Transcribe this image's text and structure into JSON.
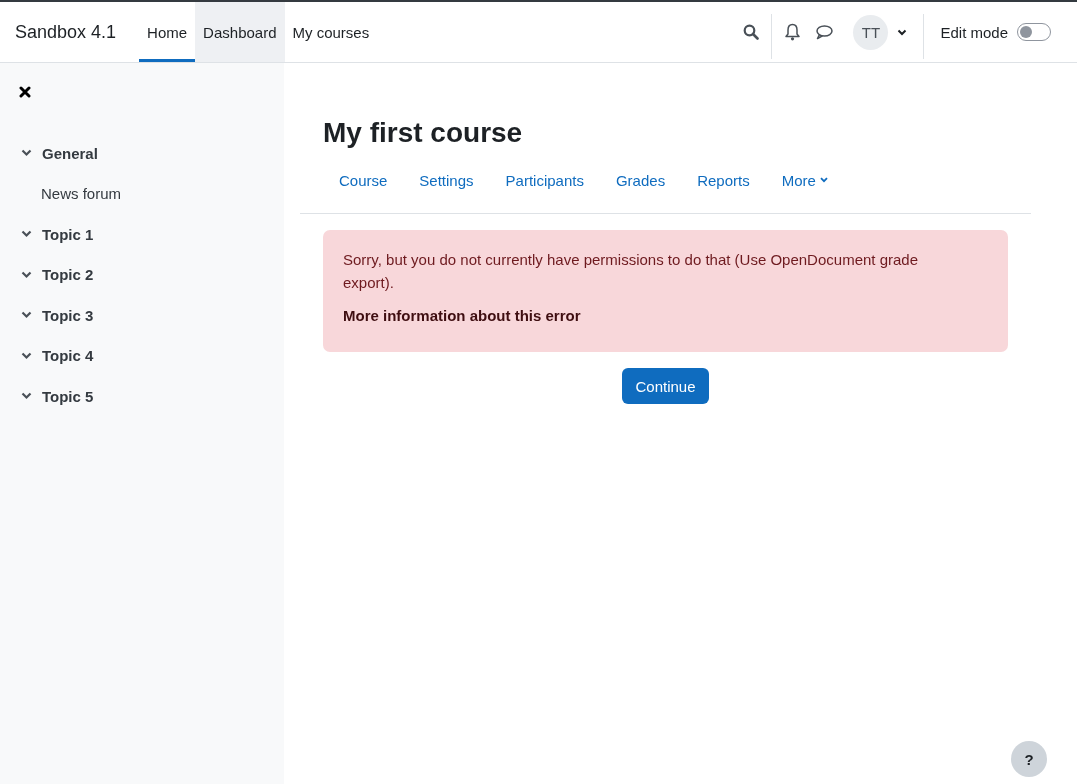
{
  "navbar": {
    "site_name": "Sandbox 4.1",
    "links": [
      {
        "label": "Home",
        "selected": true,
        "highlighted": false
      },
      {
        "label": "Dashboard",
        "selected": false,
        "highlighted": true
      },
      {
        "label": "My courses",
        "selected": false,
        "highlighted": false
      }
    ],
    "avatar_initials": "TT",
    "edit_mode": {
      "label": "Edit mode",
      "on": false
    }
  },
  "sidebar": {
    "items": [
      {
        "label": "General",
        "expanded": true,
        "children": [
          {
            "label": "News forum"
          }
        ]
      },
      {
        "label": "Topic 1",
        "expanded": true
      },
      {
        "label": "Topic 2",
        "expanded": true
      },
      {
        "label": "Topic 3",
        "expanded": true
      },
      {
        "label": "Topic 4",
        "expanded": true
      },
      {
        "label": "Topic 5",
        "expanded": true
      }
    ]
  },
  "page": {
    "title": "My first course",
    "tabs": [
      {
        "label": "Course",
        "selected": false,
        "kind": "link"
      },
      {
        "label": "Settings",
        "selected": false,
        "kind": "link"
      },
      {
        "label": "Participants",
        "selected": false,
        "kind": "link"
      },
      {
        "label": "Grades",
        "selected": false,
        "kind": "link"
      },
      {
        "label": "Reports",
        "selected": false,
        "kind": "link"
      },
      {
        "label": "More",
        "selected": false,
        "kind": "dropdown"
      }
    ],
    "alert": {
      "message": "Sorry, but you do not currently have permissions to do that (Use OpenDocument grade export).",
      "more_info": "More information about this error"
    },
    "button": "Continue"
  },
  "help_button": "?"
}
